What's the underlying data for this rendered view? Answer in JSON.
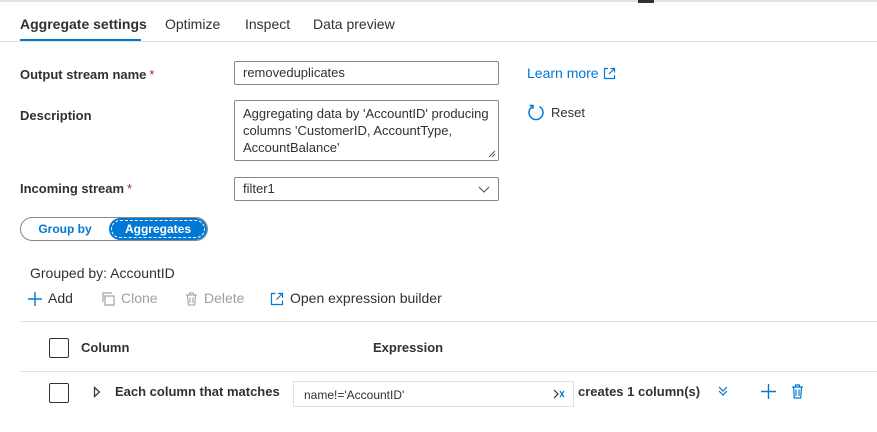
{
  "tabs": [
    {
      "label": "Aggregate settings",
      "active": true
    },
    {
      "label": "Optimize"
    },
    {
      "label": "Inspect"
    },
    {
      "label": "Data preview"
    }
  ],
  "form": {
    "output_stream": {
      "label": "Output stream name",
      "required_mark": "*",
      "value": "removeduplicates"
    },
    "description": {
      "label": "Description",
      "value": "Aggregating data by 'AccountID' producing columns 'CustomerID, AccountType, AccountBalance'"
    },
    "incoming_stream": {
      "label": "Incoming stream",
      "required_mark": "*",
      "value": "filter1"
    }
  },
  "learn_more": "Learn more",
  "reset": "Reset",
  "mode_toggle": {
    "options": [
      "Group by",
      "Aggregates"
    ],
    "selected": "Aggregates"
  },
  "grouped_by": "Grouped by: AccountID",
  "toolbar": {
    "add": "Add",
    "clone": "Clone",
    "delete": "Delete",
    "open_expr": "Open expression builder"
  },
  "table": {
    "headers": {
      "column": "Column",
      "expression": "Expression"
    },
    "rows": [
      {
        "label": "Each column that matches",
        "expression": "name!='AccountID'",
        "result": "creates 1 column(s)"
      }
    ]
  },
  "colors": {
    "accent": "#0078d4",
    "required": "#a4262c",
    "disabled": "#a19f9d"
  },
  "icons": [
    "external-link-icon",
    "reset-icon",
    "chevron-down-icon",
    "plus-icon",
    "clone-icon",
    "trash-icon",
    "open-external-icon",
    "expand-triangle-icon",
    "expression-icon",
    "chevrons-down-icon"
  ]
}
